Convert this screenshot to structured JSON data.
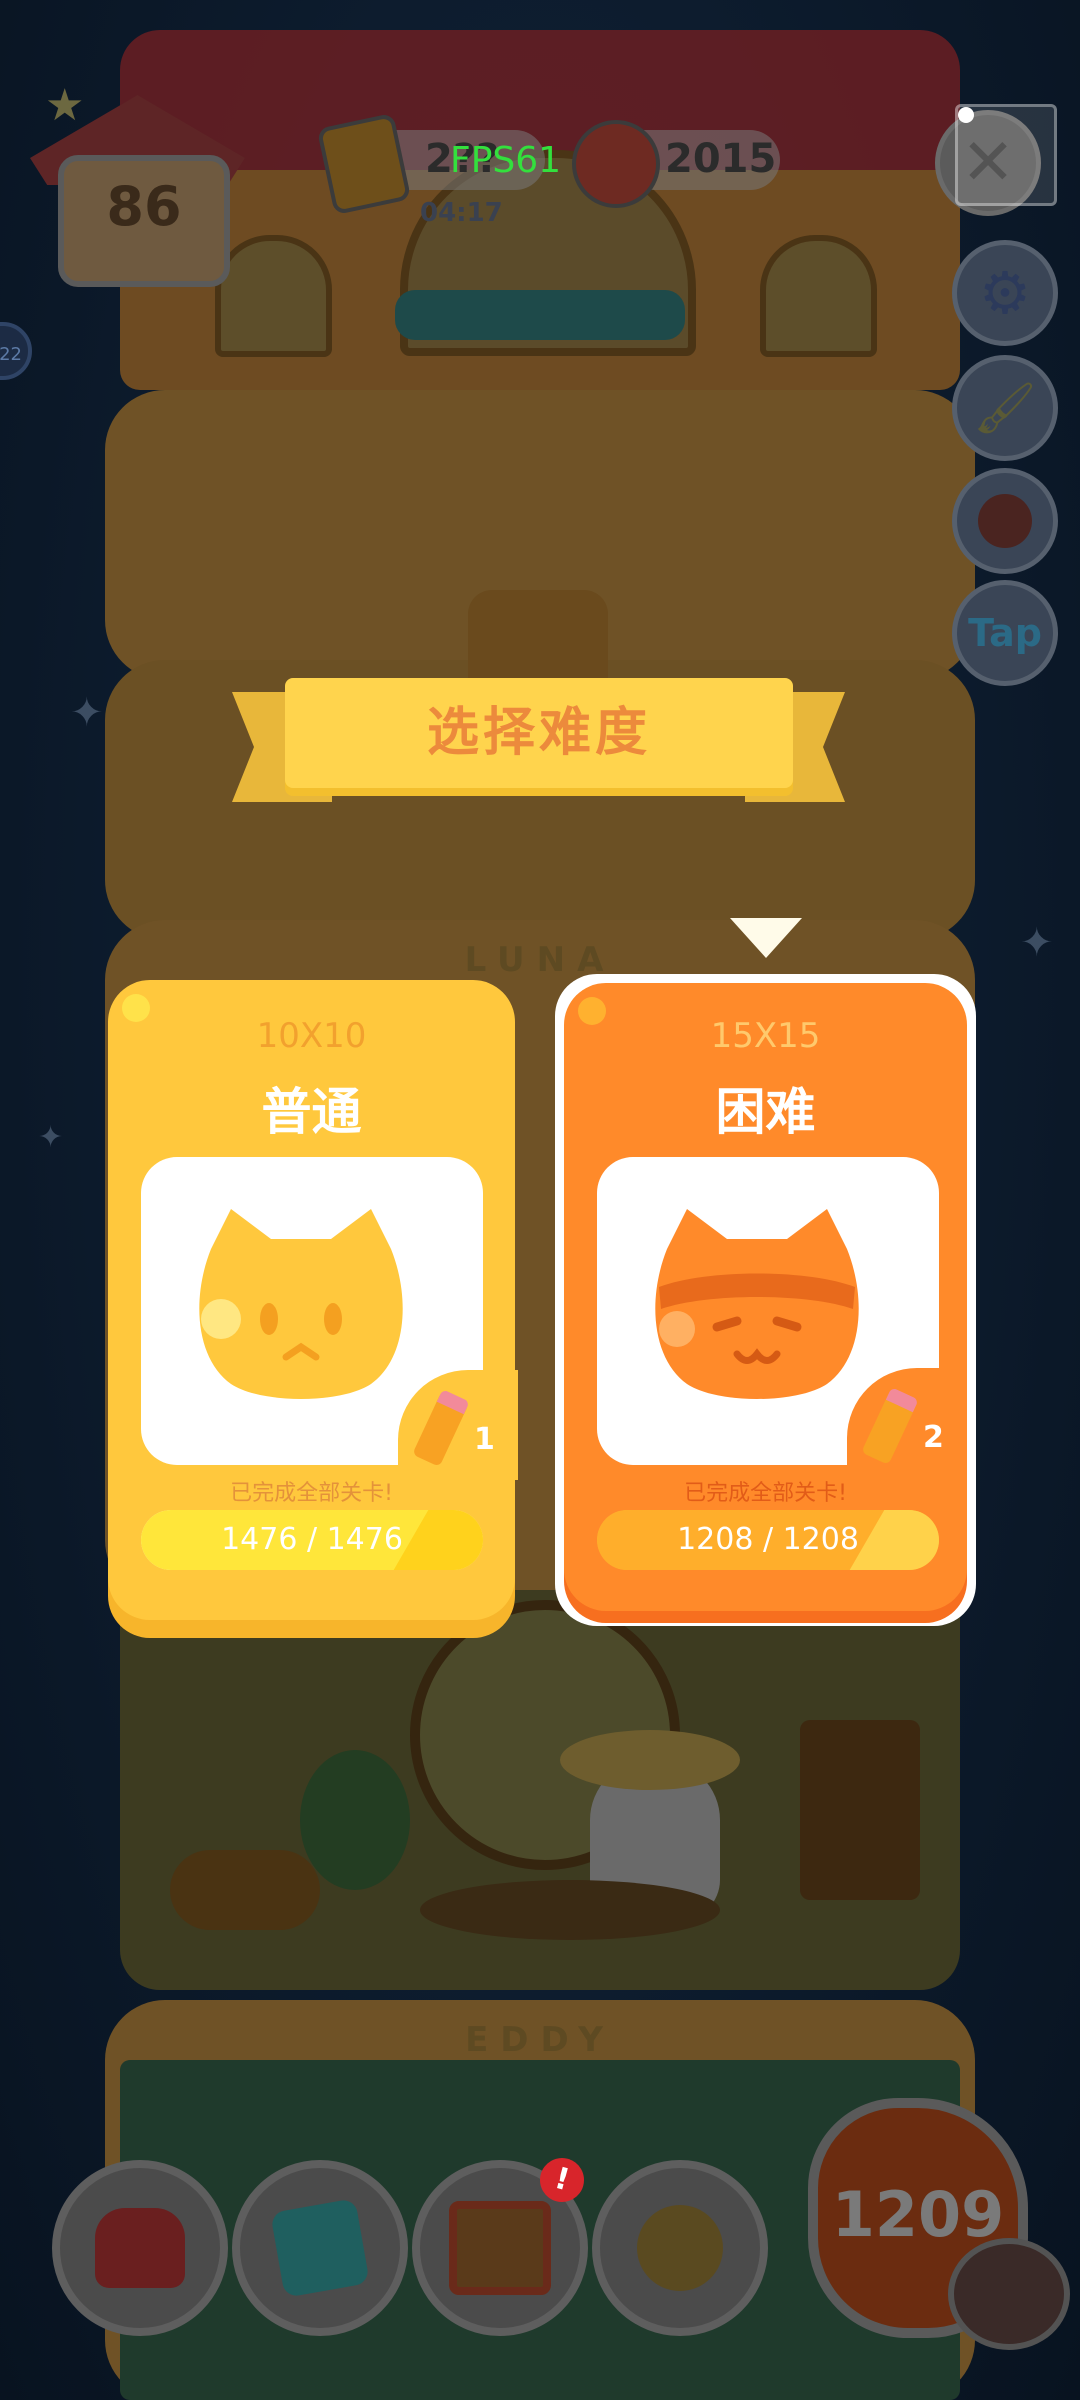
{
  "hud": {
    "house_level": "86",
    "pencil_count": "2??",
    "fps": "FPS61",
    "timer": "04:17",
    "can_count": "2015",
    "side_badge": "22"
  },
  "tower": {
    "floor_labels": [
      "LUNA",
      "EDDY"
    ]
  },
  "dialog": {
    "title": "选择难度",
    "options": [
      {
        "dims": "10X10",
        "title": "普通",
        "done_text": "已完成全部关卡!",
        "progress": "1476 / 1476",
        "pencil_cost": "1",
        "completed": 1476,
        "total": 1476
      },
      {
        "dims": "15X15",
        "title": "困难",
        "done_text": "已完成全部关卡!",
        "progress": "1208 / 1208",
        "pencil_cost": "2",
        "completed": 1208,
        "total": 1208
      }
    ],
    "selected_index": 1
  },
  "side_buttons": [
    {
      "icon": "close-icon"
    },
    {
      "icon": "gear-icon"
    },
    {
      "icon": "paint-brush-icon"
    },
    {
      "icon": "stamp-icon"
    },
    {
      "icon": "tap-icon",
      "label": "Tap"
    }
  ],
  "bottom_bar": {
    "buttons": [
      {
        "icon": "armchair-icon"
      },
      {
        "icon": "paw-book-icon"
      },
      {
        "icon": "picture-frame-icon",
        "badge": "!"
      },
      {
        "icon": "snow-globe-icon"
      }
    ],
    "puzzle_count": "1209"
  },
  "colors": {
    "normal_card": "#ffc83d",
    "hard_card": "#ff8a2a",
    "ribbon": "#ffd44d",
    "ribbon_text": "#ec8a3c"
  }
}
